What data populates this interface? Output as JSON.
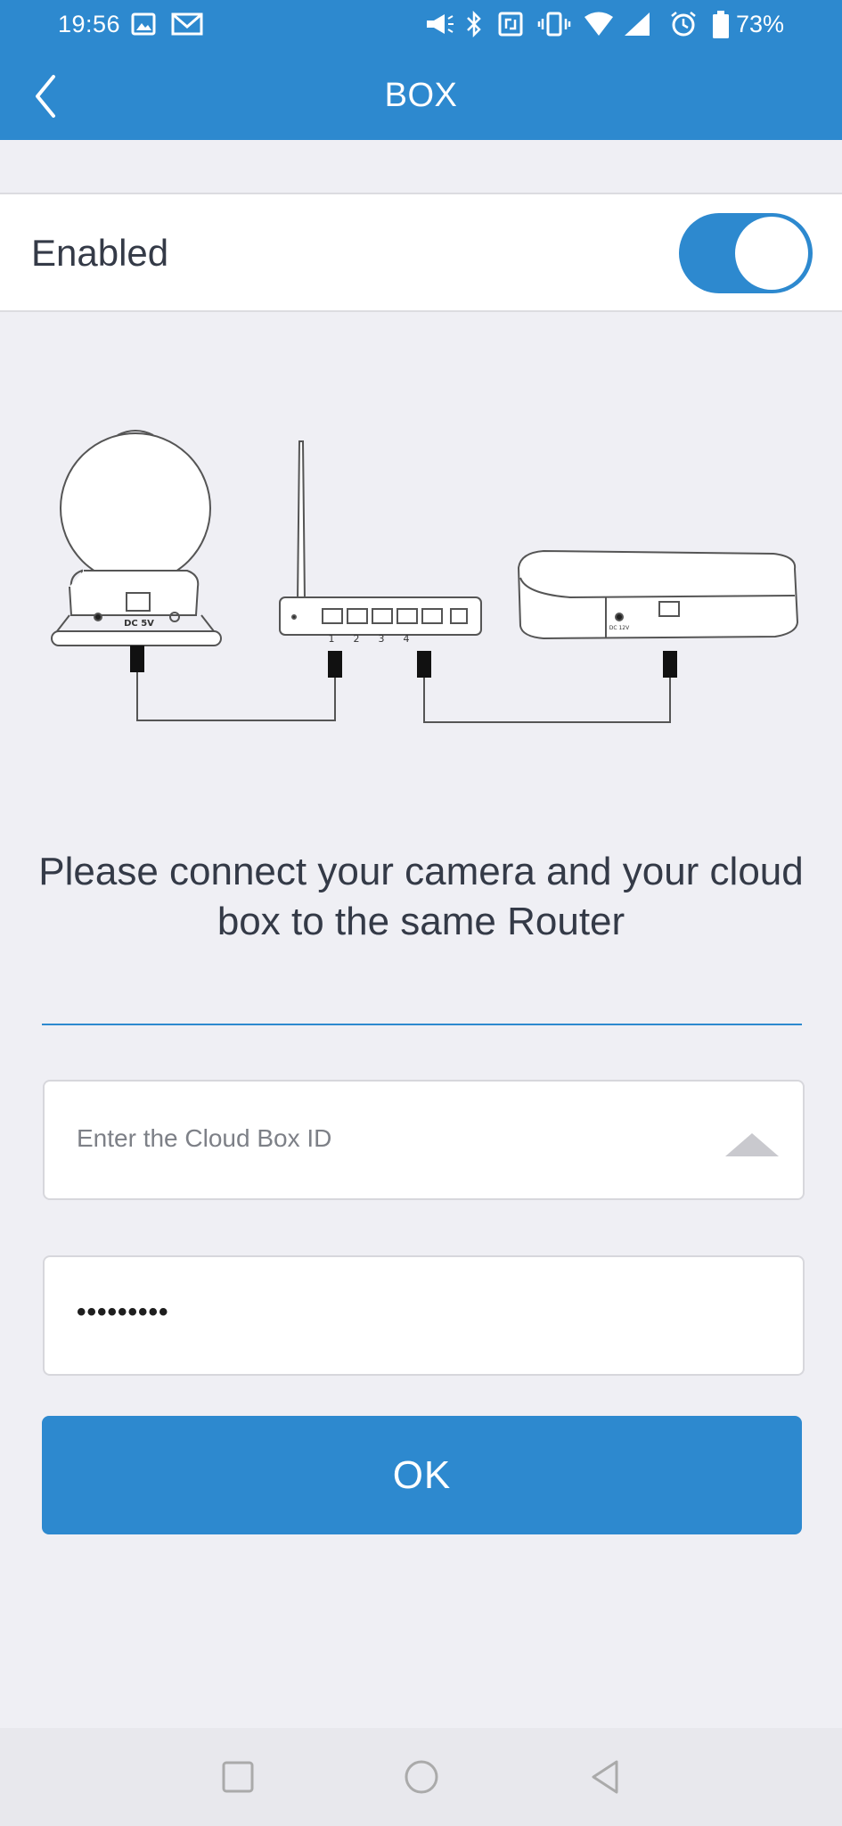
{
  "status_bar": {
    "time": "19:56",
    "icons": [
      "gallery-icon",
      "gmail-icon",
      "megaphone-icon",
      "bluetooth-icon",
      "nfc-icon",
      "vibrate-icon",
      "wifi-icon",
      "signal-icon",
      "alarm-icon",
      "battery-icon"
    ],
    "battery": "73%"
  },
  "header": {
    "title": "BOX",
    "back_icon": "chevron-left-icon"
  },
  "toggle": {
    "label": "Enabled",
    "state": "on",
    "color": "#2d89cf"
  },
  "diagram": {
    "router_port_labels": [
      "1",
      "2",
      "3",
      "4"
    ],
    "camera_port_label": "DC 5V",
    "box_port_label": "DC 12V"
  },
  "instruction": "Please connect your camera and your cloud box to the same Router",
  "form": {
    "box_id_placeholder": "Enter the Cloud Box ID",
    "password_value": "•••••••••",
    "ok_label": "OK"
  },
  "nav": {
    "buttons": [
      "recent-apps-icon",
      "home-icon",
      "back-icon"
    ]
  },
  "colors": {
    "accent": "#2d89cf",
    "background": "#efeff4"
  }
}
